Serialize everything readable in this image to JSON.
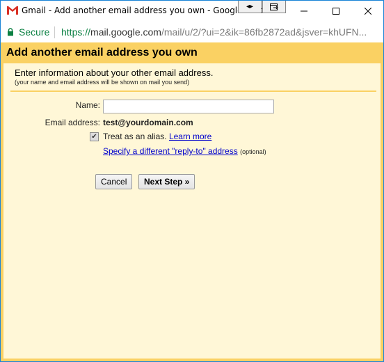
{
  "window": {
    "title": "Gmail - Add another email address you own - Google Chrome",
    "overlay_buttons": [
      "◂▸",
      "⬚"
    ],
    "controls": {
      "minimize": "—",
      "maximize": "☐",
      "close": "✕"
    }
  },
  "address_bar": {
    "secure_label": "Secure",
    "url_scheme": "https://",
    "url_host": "mail.google.com",
    "url_path": "/mail/u/2/?ui=2&ik=86fb2872ad&jsver=khUFN..."
  },
  "dialog": {
    "title": "Add another email address you own",
    "heading": "Enter information about your other email address.",
    "subheading": "(your name and email address will be shown on mail you send)",
    "name_label": "Name:",
    "name_value": "",
    "email_label": "Email address:",
    "email_value": "test@yourdomain.com",
    "alias_checked": true,
    "alias_label": "Treat as an alias.",
    "learn_more": "Learn more",
    "reply_to_link": "Specify a different \"reply-to\" address",
    "optional": "(optional)",
    "cancel_label": "Cancel",
    "next_label": "Next Step »"
  },
  "colors": {
    "frame": "#fad163",
    "panel": "#fff7d7",
    "link": "#0000cc",
    "secure": "#0b8043"
  }
}
